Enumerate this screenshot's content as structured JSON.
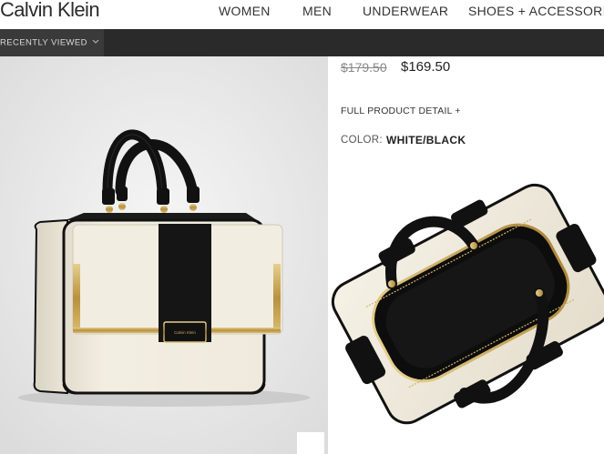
{
  "brand": {
    "logo_text": "Calvin Klein"
  },
  "nav": {
    "items": [
      "WOMEN",
      "MEN",
      "UNDERWEAR",
      "SHOES + ACCESSORIES"
    ]
  },
  "subnav": {
    "recently_viewed": "RECENTLY VIEWED",
    "icon": "chevron-down-icon"
  },
  "product": {
    "price_original": "$179.50",
    "price_sale": "$169.50",
    "full_detail_link": "FULL PRODUCT DETAIL +",
    "color_label": "COLOR:",
    "color_value": "WHITE/BLACK",
    "bag_hardware_text": "Calvin Klein"
  },
  "colors": {
    "subbar": "#2a2a2a",
    "leather_cream": "#f1ece0",
    "trim_black": "#111111",
    "hardware_gold": "#c8a55a"
  }
}
